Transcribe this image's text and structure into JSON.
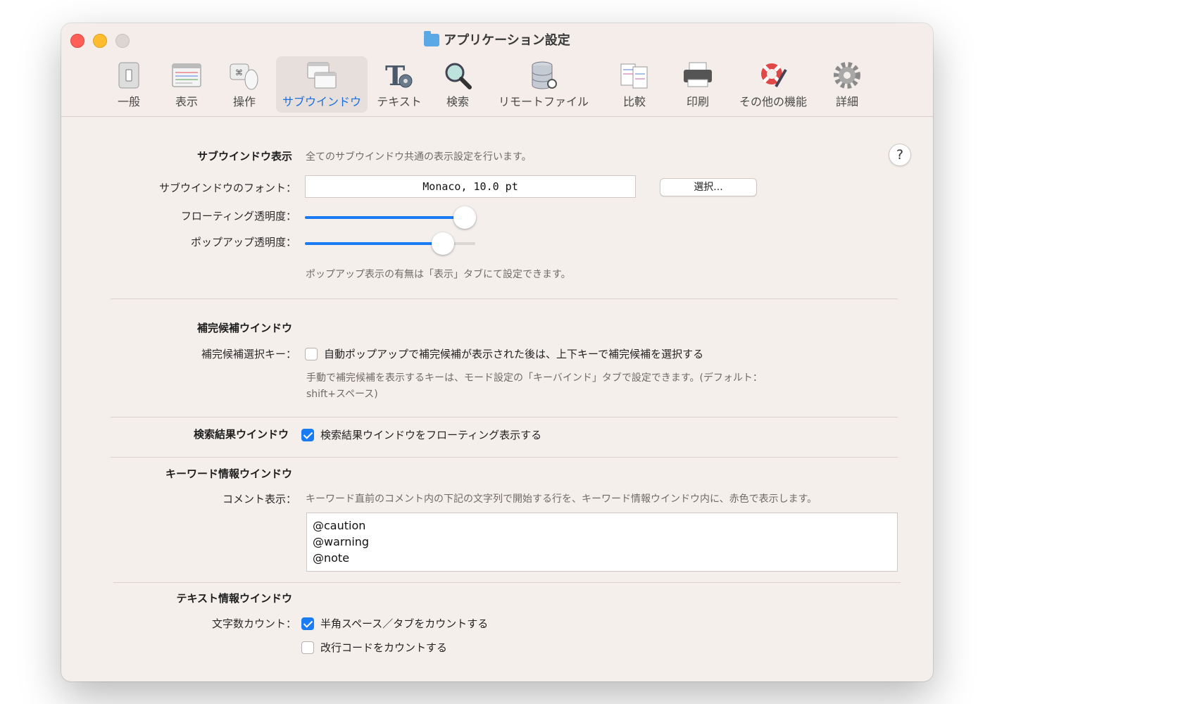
{
  "window": {
    "title": "アプリケーション設定"
  },
  "toolbar": {
    "items": [
      {
        "label": "一般",
        "icon": "switch-icon"
      },
      {
        "label": "表示",
        "icon": "window-grid-icon"
      },
      {
        "label": "操作",
        "icon": "keyboard-mouse-icon"
      },
      {
        "label": "サブウインドウ",
        "icon": "subwindow-icon",
        "active": true
      },
      {
        "label": "テキスト",
        "icon": "text-gear-icon"
      },
      {
        "label": "検索",
        "icon": "magnifier-icon"
      },
      {
        "label": "リモートファイル",
        "icon": "database-icon"
      },
      {
        "label": "比較",
        "icon": "compare-docs-icon"
      },
      {
        "label": "印刷",
        "icon": "printer-icon"
      },
      {
        "label": "その他の機能",
        "icon": "lifebuoy-pen-icon"
      },
      {
        "label": "詳細",
        "icon": "gear-icon"
      }
    ]
  },
  "help": {
    "label": "?"
  },
  "subwindow_display": {
    "heading": "サブウインドウ表示",
    "description": "全てのサブウインドウ共通の表示設定を行います。",
    "font_label": "サブウインドウのフォント：",
    "font_value": "Monaco, 10.0 pt",
    "select_button": "選択...",
    "floating_label": "フローティング透明度：",
    "floating_value": 0.94,
    "popup_label": "ポップアップ透明度：",
    "popup_value": 0.81,
    "popup_note": "ポップアップ表示の有無は「表示」タブにて設定できます。"
  },
  "completion": {
    "heading": "補完候補ウインドウ",
    "key_label": "補完候補選択キー：",
    "checkbox_label": "自動ポップアップで補完候補が表示された後は、上下キーで補完候補を選択する",
    "checked": false,
    "note_line1": "手動で補完候補を表示するキーは、モード設定の「キーバインド」タブで設定できます。(デフォルト：",
    "note_line2": "shift+スペース)"
  },
  "search_results": {
    "heading": "検索結果ウインドウ",
    "checkbox_label": "検索結果ウインドウをフローティング表示する",
    "checked": true
  },
  "keyword_info": {
    "heading": "キーワード情報ウインドウ",
    "comment_label": "コメント表示：",
    "comment_description": "キーワード直前のコメント内の下記の文字列で開始する行を、キーワード情報ウインドウ内に、赤色で表示します。",
    "lines": [
      "@caution",
      "@warning",
      "@note"
    ]
  },
  "text_info": {
    "heading": "テキスト情報ウインドウ",
    "count_label": "文字数カウント：",
    "count_spaces_label": "半角スペース／タブをカウントする",
    "count_spaces_checked": true,
    "count_newlines_label": "改行コードをカウントする",
    "count_newlines_checked": false
  },
  "colors": {
    "accent": "#1a7cf5",
    "window_bg": "#f5efec"
  }
}
